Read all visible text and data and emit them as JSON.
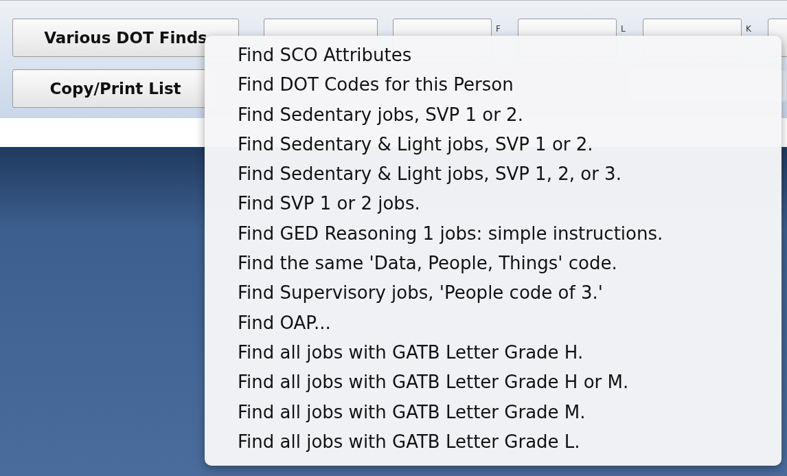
{
  "toolbar": {
    "row_1": {
      "button": "Various DOT Finds",
      "shortcut_buttons": [
        {
          "shortcut": "F"
        },
        {
          "shortcut": "L"
        },
        {
          "shortcut": "K"
        }
      ]
    },
    "row_2": {
      "button": "Copy/Print List"
    }
  },
  "menu": {
    "items": [
      {
        "label": "Find SCO Attributes"
      },
      {
        "label": "Find DOT Codes for this Person"
      },
      {
        "label": "Find Sedentary jobs, SVP 1 or 2."
      },
      {
        "label": "Find Sedentary & Light jobs, SVP 1 or 2."
      },
      {
        "label": "Find Sedentary & Light jobs, SVP 1, 2, or 3."
      },
      {
        "label": "Find SVP 1 or 2 jobs."
      },
      {
        "label": "Find GED Reasoning 1 jobs: simple instructions."
      },
      {
        "label": "Find the same 'Data, People, Things' code."
      },
      {
        "label": "Find Supervisory jobs, 'People code of 3.'"
      },
      {
        "label": "Find OAP..."
      },
      {
        "label": "Find all jobs with GATB Letter Grade H."
      },
      {
        "label": "Find all jobs with GATB Letter Grade H or M."
      },
      {
        "label": "Find all jobs with GATB Letter Grade M."
      },
      {
        "label": "Find all jobs with GATB Letter Grade L."
      }
    ]
  }
}
